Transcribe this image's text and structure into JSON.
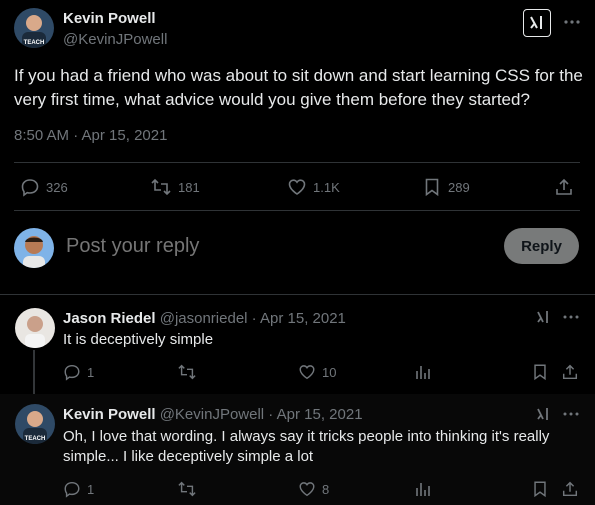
{
  "tweet": {
    "author_name": "Kevin Powell",
    "author_handle": "@KevinJPowell",
    "text": "If you had a friend who was about to sit down and start learning CSS for the very first time, what advice would you give them before they started?",
    "timestamp": "8:50 AM · Apr 15, 2021",
    "stats": {
      "replies": "326",
      "retweets": "181",
      "likes": "1.1K",
      "bookmarks": "289"
    }
  },
  "composer": {
    "placeholder": "Post your reply",
    "reply_label": "Reply"
  },
  "replies": [
    {
      "name": "Jason Riedel",
      "handle_date": "@jasonriedel · Apr 15, 2021",
      "text": "It is deceptively simple",
      "replies": "1",
      "likes": "10"
    },
    {
      "name": "Kevin Powell",
      "handle_date": "@KevinJPowell · Apr 15, 2021",
      "text": "Oh, I love that wording. I always say it tricks people into thinking it's really simple... I like deceptively simple a lot",
      "replies": "1",
      "likes": "8"
    }
  ],
  "colors": {
    "background": "#000000",
    "text": "#e7e9ea",
    "muted": "#71767b",
    "divider": "#2f3336",
    "reply_button": "#787a7a"
  },
  "icons": [
    "grok-icon",
    "more-icon",
    "reply-icon",
    "retweet-icon",
    "like-icon",
    "bookmark-icon",
    "share-icon",
    "views-icon"
  ]
}
